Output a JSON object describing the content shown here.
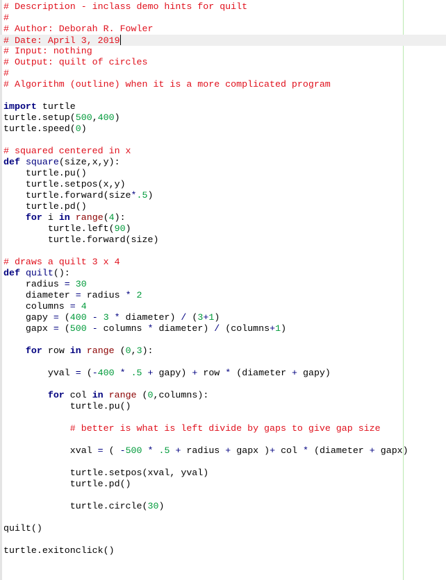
{
  "editor": {
    "current_line": 4,
    "lines": [
      [
        [
          "c",
          "# Description - inclass demo hints for quilt"
        ]
      ],
      [
        [
          "c",
          "#"
        ]
      ],
      [
        [
          "c",
          "# Author: Deborah R. Fowler"
        ]
      ],
      [
        [
          "c",
          "# Date: April 3, 2019"
        ]
      ],
      [
        [
          "c",
          "# Input: nothing"
        ]
      ],
      [
        [
          "c",
          "# Output: quilt of circles"
        ]
      ],
      [
        [
          "c",
          "#"
        ]
      ],
      [
        [
          "c",
          "# Algorithm (outline) when it is a more complicated program"
        ]
      ],
      [],
      [
        [
          "k",
          "import"
        ],
        [
          "d",
          " turtle"
        ]
      ],
      [
        [
          "d",
          "turtle.setup("
        ],
        [
          "n",
          "500"
        ],
        [
          "d",
          ","
        ],
        [
          "n",
          "400"
        ],
        [
          "d",
          ")"
        ]
      ],
      [
        [
          "d",
          "turtle.speed("
        ],
        [
          "n",
          "0"
        ],
        [
          "d",
          ")"
        ]
      ],
      [],
      [
        [
          "c",
          "# squared centered in x"
        ]
      ],
      [
        [
          "k",
          "def"
        ],
        [
          "d",
          " "
        ],
        [
          "f",
          "square"
        ],
        [
          "d",
          "(size,x,y):"
        ]
      ],
      [
        [
          "d",
          "    turtle.pu()"
        ]
      ],
      [
        [
          "d",
          "    turtle.setpos(x,y)"
        ]
      ],
      [
        [
          "d",
          "    turtle.forward(size"
        ],
        [
          "o",
          "*"
        ],
        [
          "n",
          ".5"
        ],
        [
          "d",
          ")"
        ]
      ],
      [
        [
          "d",
          "    turtle.pd()"
        ]
      ],
      [
        [
          "d",
          "    "
        ],
        [
          "k",
          "for"
        ],
        [
          "d",
          " i "
        ],
        [
          "k",
          "in"
        ],
        [
          "d",
          " "
        ],
        [
          "b",
          "range"
        ],
        [
          "d",
          "("
        ],
        [
          "n",
          "4"
        ],
        [
          "d",
          "):"
        ]
      ],
      [
        [
          "d",
          "        turtle.left("
        ],
        [
          "n",
          "90"
        ],
        [
          "d",
          ")"
        ]
      ],
      [
        [
          "d",
          "        turtle.forward(size)"
        ]
      ],
      [],
      [
        [
          "c",
          "# draws a quilt 3 x 4"
        ]
      ],
      [
        [
          "k",
          "def"
        ],
        [
          "d",
          " "
        ],
        [
          "f",
          "quilt"
        ],
        [
          "d",
          "():"
        ]
      ],
      [
        [
          "d",
          "    radius "
        ],
        [
          "o",
          "="
        ],
        [
          "d",
          " "
        ],
        [
          "n",
          "30"
        ]
      ],
      [
        [
          "d",
          "    diameter "
        ],
        [
          "o",
          "="
        ],
        [
          "d",
          " radius "
        ],
        [
          "o",
          "*"
        ],
        [
          "d",
          " "
        ],
        [
          "n",
          "2"
        ]
      ],
      [
        [
          "d",
          "    columns "
        ],
        [
          "o",
          "="
        ],
        [
          "d",
          " "
        ],
        [
          "n",
          "4"
        ]
      ],
      [
        [
          "d",
          "    gapy "
        ],
        [
          "o",
          "="
        ],
        [
          "d",
          " ("
        ],
        [
          "n",
          "400"
        ],
        [
          "d",
          " "
        ],
        [
          "o",
          "-"
        ],
        [
          "d",
          " "
        ],
        [
          "n",
          "3"
        ],
        [
          "d",
          " "
        ],
        [
          "o",
          "*"
        ],
        [
          "d",
          " diameter) "
        ],
        [
          "o",
          "/"
        ],
        [
          "d",
          " ("
        ],
        [
          "n",
          "3"
        ],
        [
          "o",
          "+"
        ],
        [
          "n",
          "1"
        ],
        [
          "d",
          ")"
        ]
      ],
      [
        [
          "d",
          "    gapx "
        ],
        [
          "o",
          "="
        ],
        [
          "d",
          " ("
        ],
        [
          "n",
          "500"
        ],
        [
          "d",
          " "
        ],
        [
          "o",
          "-"
        ],
        [
          "d",
          " columns "
        ],
        [
          "o",
          "*"
        ],
        [
          "d",
          " diameter) "
        ],
        [
          "o",
          "/"
        ],
        [
          "d",
          " (columns"
        ],
        [
          "o",
          "+"
        ],
        [
          "n",
          "1"
        ],
        [
          "d",
          ")"
        ]
      ],
      [],
      [
        [
          "d",
          "    "
        ],
        [
          "k",
          "for"
        ],
        [
          "d",
          " row "
        ],
        [
          "k",
          "in"
        ],
        [
          "d",
          " "
        ],
        [
          "b",
          "range"
        ],
        [
          "d",
          " ("
        ],
        [
          "n",
          "0"
        ],
        [
          "d",
          ","
        ],
        [
          "n",
          "3"
        ],
        [
          "d",
          "):"
        ]
      ],
      [],
      [
        [
          "d",
          "        yval "
        ],
        [
          "o",
          "="
        ],
        [
          "d",
          " ("
        ],
        [
          "o",
          "-"
        ],
        [
          "n",
          "400"
        ],
        [
          "d",
          " "
        ],
        [
          "o",
          "*"
        ],
        [
          "d",
          " "
        ],
        [
          "n",
          ".5"
        ],
        [
          "d",
          " "
        ],
        [
          "o",
          "+"
        ],
        [
          "d",
          " gapy) "
        ],
        [
          "o",
          "+"
        ],
        [
          "d",
          " row "
        ],
        [
          "o",
          "*"
        ],
        [
          "d",
          " (diameter "
        ],
        [
          "o",
          "+"
        ],
        [
          "d",
          " gapy)"
        ]
      ],
      [],
      [
        [
          "d",
          "        "
        ],
        [
          "k",
          "for"
        ],
        [
          "d",
          " col "
        ],
        [
          "k",
          "in"
        ],
        [
          "d",
          " "
        ],
        [
          "b",
          "range"
        ],
        [
          "d",
          " ("
        ],
        [
          "n",
          "0"
        ],
        [
          "d",
          ",columns):"
        ]
      ],
      [
        [
          "d",
          "            turtle.pu()"
        ]
      ],
      [],
      [
        [
          "d",
          "            "
        ],
        [
          "c",
          "# better is what is left divide by gaps to give gap size"
        ]
      ],
      [],
      [
        [
          "d",
          "            xval "
        ],
        [
          "o",
          "="
        ],
        [
          "d",
          " ( "
        ],
        [
          "o",
          "-"
        ],
        [
          "n",
          "500"
        ],
        [
          "d",
          " "
        ],
        [
          "o",
          "*"
        ],
        [
          "d",
          " "
        ],
        [
          "n",
          ".5"
        ],
        [
          "d",
          " "
        ],
        [
          "o",
          "+"
        ],
        [
          "d",
          " radius "
        ],
        [
          "o",
          "+"
        ],
        [
          "d",
          " gapx )"
        ],
        [
          "o",
          "+"
        ],
        [
          "d",
          " col "
        ],
        [
          "o",
          "*"
        ],
        [
          "d",
          " (diameter "
        ],
        [
          "o",
          "+"
        ],
        [
          "d",
          " gapx)"
        ]
      ],
      [],
      [
        [
          "d",
          "            turtle.setpos(xval, yval)"
        ]
      ],
      [
        [
          "d",
          "            turtle.pd()"
        ]
      ],
      [],
      [
        [
          "d",
          "            turtle.circle("
        ],
        [
          "n",
          "30"
        ],
        [
          "d",
          ")"
        ]
      ],
      [],
      [
        [
          "d",
          "quilt()"
        ]
      ],
      [],
      [
        [
          "d",
          "turtle.exitonclick()"
        ]
      ]
    ]
  },
  "colors": {
    "comment": "#e0101c",
    "keyword": "#00007f",
    "number": "#009a3a",
    "builtin": "#8b0000",
    "edge_line": "#b9e8b0"
  }
}
